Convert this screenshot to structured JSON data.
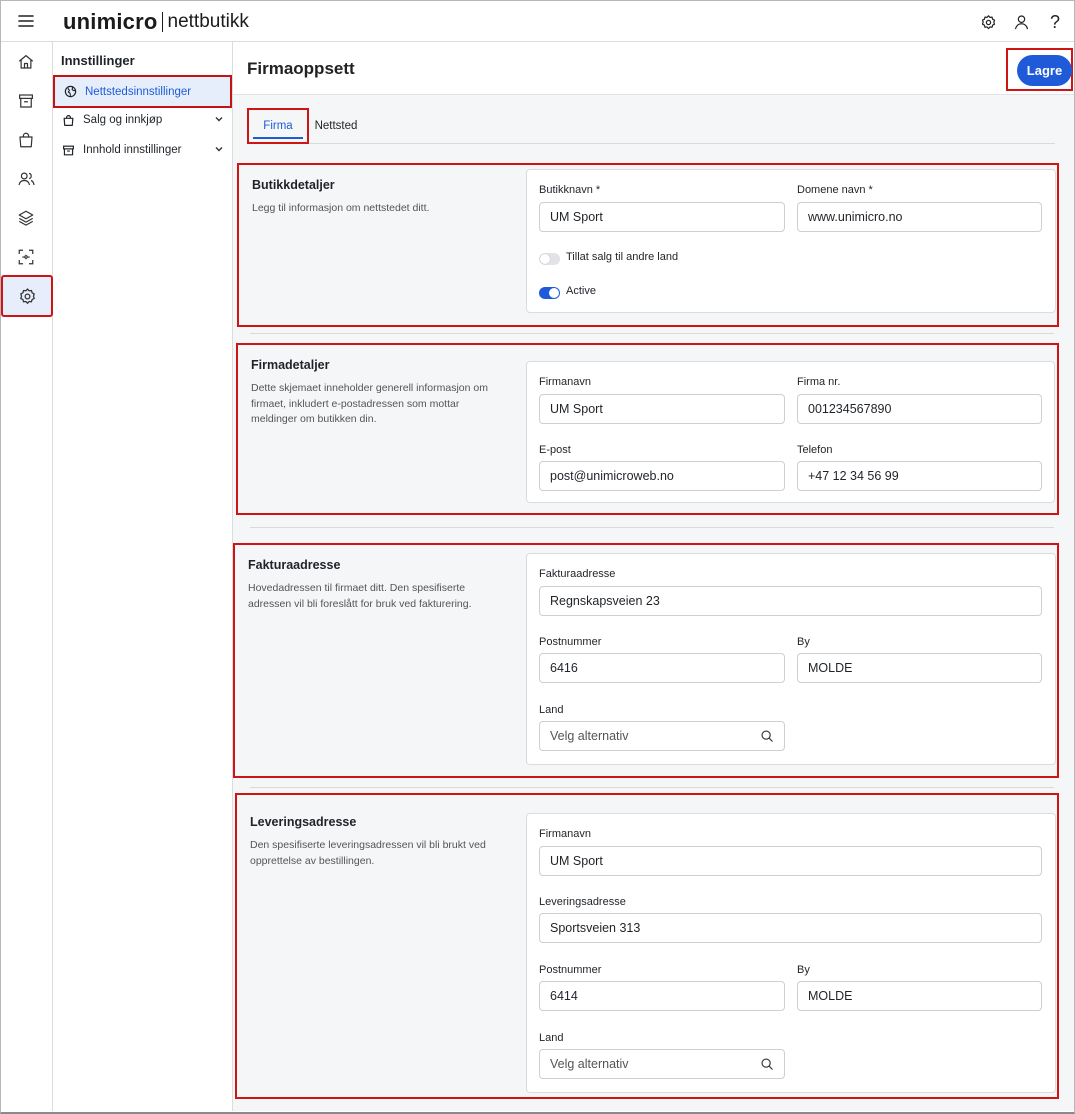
{
  "app": {
    "brand": "unimicro",
    "product": "nettbutikk"
  },
  "topbar_icons": [
    "settings-icon",
    "user-icon",
    "help-icon"
  ],
  "help_glyph": "?",
  "rail": [
    "home-icon",
    "store-icon",
    "shopping-bag-icon",
    "users-icon",
    "layers-icon",
    "scan-icon",
    "settings-icon"
  ],
  "subnav": {
    "title": "Innstillinger",
    "items": [
      {
        "label": "Nettstedsinnstillinger",
        "selected": true
      },
      {
        "label": "Salg og innkjøp"
      },
      {
        "label": "Innhold innstillinger"
      }
    ]
  },
  "page": {
    "title": "Firmaoppsett",
    "save_label": "Lagre"
  },
  "tabs": [
    "Firma",
    "Nettsted"
  ],
  "sections": {
    "butikk": {
      "title": "Butikkdetaljer",
      "desc": "Legg til informasjon om nettstedet ditt.",
      "butikknavn_label": "Butikknavn *",
      "butikknavn_value": "UM Sport",
      "domene_label": "Domene navn *",
      "domene_value": "www.unimicro.no",
      "toggle1_label": "Tillat salg til andre land",
      "toggle1_on": false,
      "toggle2_label": "Active",
      "toggle2_on": true
    },
    "firma": {
      "title": "Firmadetaljer",
      "desc": "Dette skjemaet inneholder generell informasjon om firmaet, inkludert e-postadressen som mottar meldinger om butikken din.",
      "firmanavn_label": "Firmanavn",
      "firmanavn_value": "UM Sport",
      "firmanr_label": "Firma nr.",
      "firmanr_value": "001234567890",
      "epost_label": "E-post",
      "epost_value": "post@unimicroweb.no",
      "telefon_label": "Telefon",
      "telefon_value": "+47 12 34 56 99"
    },
    "faktura": {
      "title": "Fakturaadresse",
      "desc": "Hovedadressen til firmaet ditt. Den spesifiserte adressen vil bli foreslått for bruk ved fakturering.",
      "adresse_label": "Fakturaadresse",
      "adresse_value": "Regnskapsveien 23",
      "postnr_label": "Postnummer",
      "postnr_value": "6416",
      "by_label": "By",
      "by_value": "MOLDE",
      "land_label": "Land",
      "land_placeholder": "Velg alternativ"
    },
    "levering": {
      "title": "Leveringsadresse",
      "desc": "Den spesifiserte leveringsadressen vil bli brukt ved opprettelse av bestillingen.",
      "firmanavn_label": "Firmanavn",
      "firmanavn_value": "UM Sport",
      "adresse_label": "Leveringsadresse",
      "adresse_value": "Sportsveien 313",
      "postnr_label": "Postnummer",
      "postnr_value": "6414",
      "by_label": "By",
      "by_value": "MOLDE",
      "land_label": "Land",
      "land_placeholder": "Velg alternativ"
    }
  },
  "colors": {
    "accent": "#1f5bd8",
    "highlight_border": "#d01414",
    "selected_bg": "#e6eefc",
    "panel_bg": "#f5f6f7"
  }
}
